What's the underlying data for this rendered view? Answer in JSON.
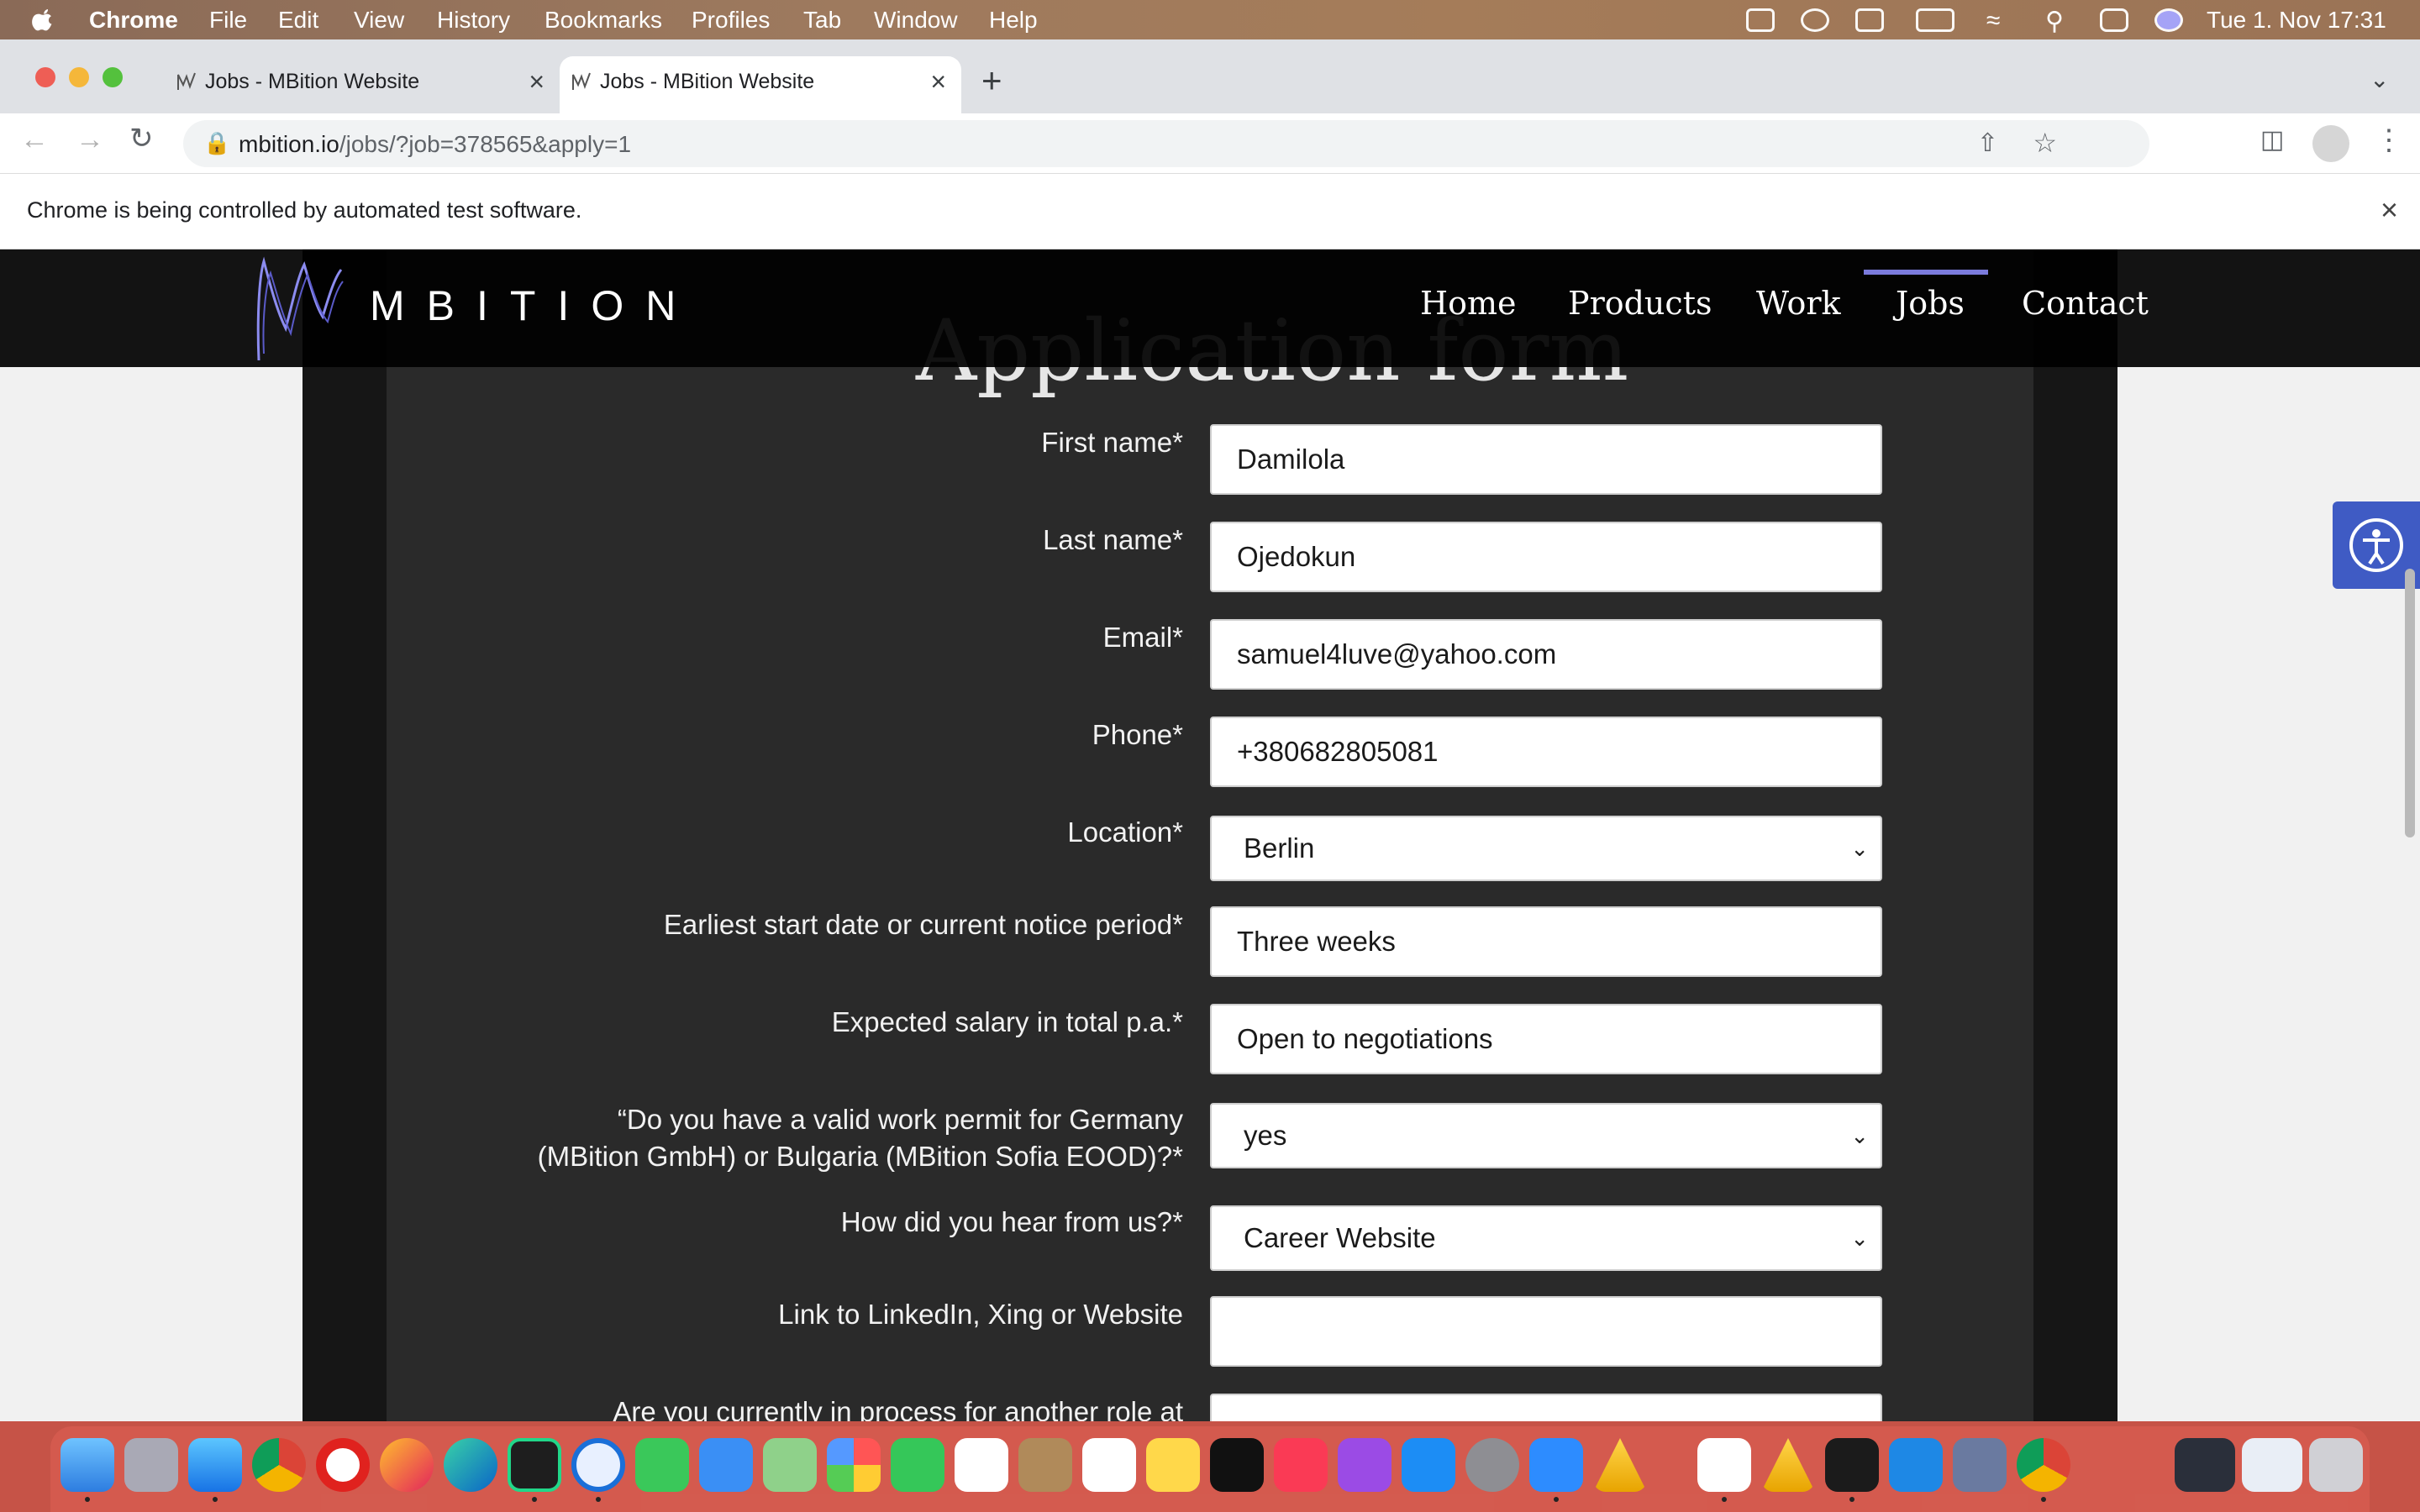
{
  "menubar": {
    "app": "Chrome",
    "items": [
      "File",
      "Edit",
      "View",
      "History",
      "Bookmarks",
      "Profiles",
      "Tab",
      "Window",
      "Help"
    ],
    "clock": "Tue 1. Nov  17:31"
  },
  "tabs": [
    {
      "title": "Jobs - MBition Website",
      "active": false
    },
    {
      "title": "Jobs - MBition Website",
      "active": true
    }
  ],
  "toolbar": {
    "url_host": "mbition.io",
    "url_path": "/jobs/?job=378565&apply=1"
  },
  "infobar": {
    "message": "Chrome is being controlled by automated test software."
  },
  "site": {
    "logo": "MBITION",
    "nav": [
      "Home",
      "Products",
      "Work",
      "Jobs",
      "Contact"
    ],
    "active_nav": "Jobs"
  },
  "form": {
    "title": "Application form",
    "fields": {
      "first_name": {
        "label": "First name*",
        "value": "Damilola"
      },
      "last_name": {
        "label": "Last name*",
        "value": "Ojedokun"
      },
      "email": {
        "label": "Email*",
        "value": "samuel4luve@yahoo.com"
      },
      "phone": {
        "label": "Phone*",
        "value": "+380682805081"
      },
      "location": {
        "label": "Location*",
        "value": "Berlin"
      },
      "start_date": {
        "label": "Earliest start date or current notice period*",
        "value": "Three weeks"
      },
      "salary": {
        "label": "Expected salary in total p.a.*",
        "value": "Open to negotiations"
      },
      "work_permit": {
        "label_line1": "“Do you have a valid work permit for Germany",
        "label_line2": "(MBition GmbH) or Bulgaria (MBition Sofia EOOD)?*",
        "value": "yes"
      },
      "hear_from": {
        "label": "How did you hear from us?*",
        "value": "Career Website"
      },
      "linkedin": {
        "label": "Link to LinkedIn, Xing or Website",
        "value": ""
      },
      "other_process": {
        "label": "Are you currently in process for another role at",
        "value": ""
      }
    }
  },
  "colors": {
    "page_bg": "#f1f1f1",
    "panel_bg": "#2a2a2a",
    "nav_active": "#7b7bdc",
    "accessibility_button": "#3f5bc4"
  }
}
